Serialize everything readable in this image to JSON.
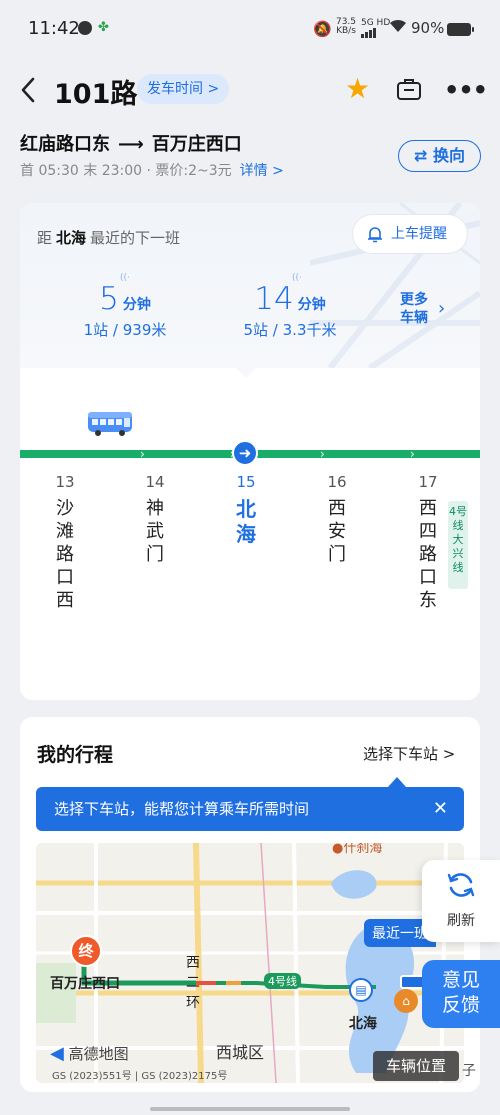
{
  "status_bar": {
    "time": "11:42",
    "net_speed_value": "73.5",
    "net_speed_unit": "KB/s",
    "signal": "5G HD",
    "battery": "90%"
  },
  "header": {
    "title": "101路",
    "schedule_label": "发车时间",
    "schedule_chevron": ">"
  },
  "route": {
    "from": "红庙路口东",
    "arrow": "⟶",
    "to": "百万庄西口",
    "info": "首 05:30 末 23:00 · 票价:2~3元",
    "detail_label": "详情",
    "detail_chevron": ">",
    "swap_label": "⇄ 换向"
  },
  "next_bus": {
    "prefix": "距",
    "stop": "北海",
    "suffix": "最近的下一班",
    "remind_label": "上车提醒",
    "eta1": {
      "minutes": "5",
      "unit": "分钟",
      "detail": "1站 / 939米"
    },
    "eta2": {
      "minutes": "14",
      "unit": "分钟",
      "detail": "5站 / 3.3千米"
    },
    "more_line1": "更多",
    "more_line2": "车辆"
  },
  "stops": [
    {
      "num": "13",
      "name": "沙滩路口西"
    },
    {
      "num": "14",
      "name": "神武门"
    },
    {
      "num": "15",
      "name": "北海"
    },
    {
      "num": "16",
      "name": "西安门"
    },
    {
      "num": "17",
      "name": "西四路口东"
    }
  ],
  "transfer_tag": "4号线大兴线",
  "trip": {
    "title": "我的行程",
    "choose_label": "选择下车站",
    "choose_chevron": ">",
    "tip": "选择下车站，能帮您计算乘车所需时间"
  },
  "map": {
    "end_marker": "终",
    "end_stop": "百万庄西口",
    "xierhuan": "西二环",
    "line4": "4号线",
    "nearest_label": "最近一班",
    "beihai": "北海",
    "xicheng": "西城区",
    "shichahai_fragment": "什刹海",
    "amap_brand": "高德地图",
    "license": "GS (2023)551号 | GS (2023)2175号",
    "vehicle_pos": "车辆位置",
    "edge_char": "子"
  },
  "floating": {
    "refresh_label": "刷新",
    "feedback_line1": "意见",
    "feedback_line2": "反馈"
  },
  "colors": {
    "primary": "#1f6fe0",
    "line_green": "#19ad6a",
    "star": "#f6a800",
    "end_marker": "#ef5a2a"
  }
}
